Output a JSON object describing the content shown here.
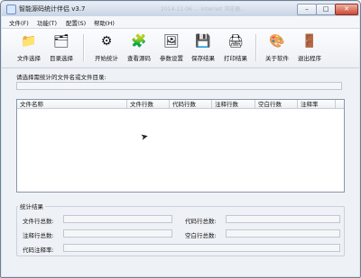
{
  "window": {
    "title": "智能源码统计伴侣 v3.7",
    "faded_title": "2014-11-06 ... Internet 浏览器..."
  },
  "controls": {
    "minimize": "–",
    "maximize": "□",
    "close": "✕"
  },
  "menu": [
    {
      "label": "文件(F)"
    },
    {
      "label": "功能(T)"
    },
    {
      "label": "配置(S)"
    },
    {
      "label": "帮助(H)"
    }
  ],
  "toolbar": [
    {
      "label": "文件选择",
      "icon": "📁"
    },
    {
      "label": "目录选择",
      "icon": "🗂"
    },
    {
      "label": "开始统计",
      "icon": "⚙"
    },
    {
      "label": "查看源码",
      "icon": "🧩"
    },
    {
      "label": "参数设置",
      "icon": "🖼"
    },
    {
      "label": "保存结果",
      "icon": "💾"
    },
    {
      "label": "打印结果",
      "icon": "🖨"
    },
    {
      "label": "关于软件",
      "icon": "🎨"
    },
    {
      "label": "退出程序",
      "icon": "🚪"
    }
  ],
  "selection": {
    "prompt": "请选择需统计的文件名或文件目录:",
    "path_value": ""
  },
  "columns": [
    "文件名称",
    "文件行数",
    "代码行数",
    "注释行数",
    "空白行数",
    "注释率"
  ],
  "stats": {
    "title": "统计结果",
    "file_total_label": "文件行总数:",
    "code_total_label": "代码行总数:",
    "comment_total_label": "注释行总数:",
    "blank_total_label": "空白行总数:",
    "code_comment_rate_label": "代码注释率:",
    "file_total_value": "",
    "code_total_value": "",
    "comment_total_value": "",
    "blank_total_value": "",
    "code_comment_rate_value": ""
  }
}
